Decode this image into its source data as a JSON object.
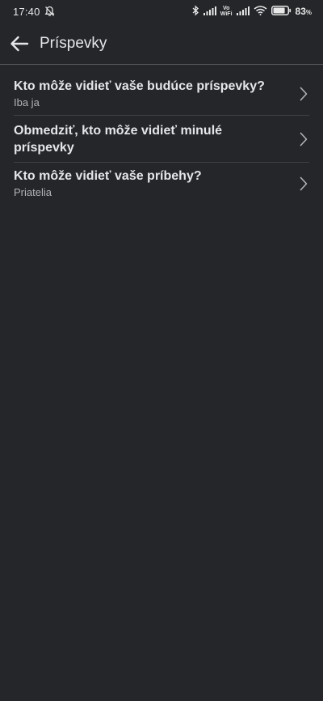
{
  "status_bar": {
    "time": "17:40",
    "volte_top": "Vo",
    "volte_bottom": "WiFi",
    "battery_percent": "83",
    "battery_unit": "%",
    "battery_level": 0.83
  },
  "header": {
    "title": "Príspevky"
  },
  "items": [
    {
      "title": "Kto môže vidieť vaše budúce príspevky?",
      "subtitle": "Iba ja"
    },
    {
      "title": "Obmedziť, kto môže vidieť minulé príspevky",
      "subtitle": ""
    },
    {
      "title": "Kto môže vidieť vaše príbehy?",
      "subtitle": "Priatelia"
    }
  ],
  "colors": {
    "background": "#242629",
    "text_primary": "#e4e6eb",
    "text_secondary": "#b0b3b8"
  }
}
